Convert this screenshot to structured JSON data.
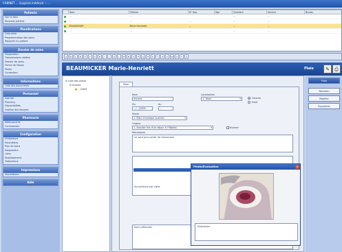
{
  "window": {
    "title": "CABINET … (Logiciel médical) — …"
  },
  "sidebar": {
    "sections": [
      {
        "title": "Patients",
        "items": [
          "Voir la liste",
          "Nouveau patient"
        ]
      },
      {
        "title": "Planifications",
        "items": [
          "Calendrier",
          "Programmation des soins",
          "Rapports du patient"
        ]
      },
      {
        "title": "Dossier de soins",
        "items": [
          "Diagnostics",
          "Transmissions ciblées",
          "Dossier de soins",
          "Fiches de liaison",
          "Plaies",
          "Contention"
        ]
      },
      {
        "title": "Informations",
        "items": [
          "Liste des documents"
        ]
      },
      {
        "title": "Personnel",
        "items": [
          "Agenda",
          "Planning",
          "Disponibilités",
          "Gestion des équipes"
        ]
      },
      {
        "title": "Pharmacie",
        "items": [
          "Médicaments",
          "Commandes"
        ]
      },
      {
        "title": "Configuration",
        "items": [
          "Utilisateurs",
          "Paramètres",
          "Plan de soins",
          "Diagnostics",
          "Liens",
          "Établissement",
          "Traductions"
        ]
      },
      {
        "title": "Impressions",
        "items": [
          "Impressions"
        ]
      },
      {
        "title": "Aide",
        "items": []
      }
    ]
  },
  "patient_table": {
    "columns": [
      "",
      "Nom",
      "Prénom",
      "N° Dos.",
      "Âge",
      "Chambre",
      "Service",
      "Bureau"
    ],
    "rows": [
      {
        "cells": [
          "",
          "…",
          "…",
          "",
          "",
          "…",
          "…",
          ""
        ],
        "selected": false
      },
      {
        "cells": [
          "",
          "…",
          "…",
          "…",
          "",
          "…",
          "…",
          ""
        ],
        "selected": false
      },
      {
        "cells": [
          "",
          "BEAUMICKER",
          "Marie-Henriette",
          "…",
          "",
          "…",
          "…",
          ""
        ],
        "selected": true
      },
      {
        "cells": [
          "",
          "…",
          "…",
          "…",
          "",
          "…",
          "…",
          ""
        ],
        "selected": false
      }
    ]
  },
  "alphabet": [
    "A",
    "B",
    "C",
    "D",
    "E",
    "F",
    "G",
    "H",
    "I",
    "J",
    "K",
    "L",
    "M",
    "N",
    "O",
    "P",
    "Q",
    "R",
    "S",
    "T",
    "U",
    "V",
    "W",
    "X",
    "Y",
    "Z"
  ],
  "banner": {
    "patient_name": "BEAUMICKER Marie-Henriett",
    "right_label": "Plaie"
  },
  "tree": {
    "root": "Liste des plaies",
    "child": "escarre",
    "leaf": "…/2009"
  },
  "form": {
    "tab_label": "Plaie",
    "nom_label": "Nom",
    "nom_value": "escarre",
    "localisation_label": "Localisation",
    "localisation_value": "1. Talon",
    "side_left": "Gauche",
    "side_right": "Droit",
    "du_label": "Du",
    "du_value": "…/…/2009",
    "au_label": "Au",
    "au_value": "…",
    "stade_label": "Stade",
    "stade_value": "1. Plaie chronique ouverte",
    "origine_label": "Origine",
    "origine_value": "1. Acquise lors d'un séjour à l'hôpital",
    "escarre_label": "Escarre",
    "remarques_label": "Remarques",
    "remarques_value": "ne peut plus porter de chaussures",
    "evaluation_label": "Surveillance par visite",
    "soins_label": "Soins effectués"
  },
  "right_buttons": [
    "Plaie",
    "Nouveau",
    "Modifier",
    "Supprimer"
  ],
  "popup": {
    "title": "Photo/Évaluation",
    "close": "x",
    "caption_label": "Évaluation"
  }
}
